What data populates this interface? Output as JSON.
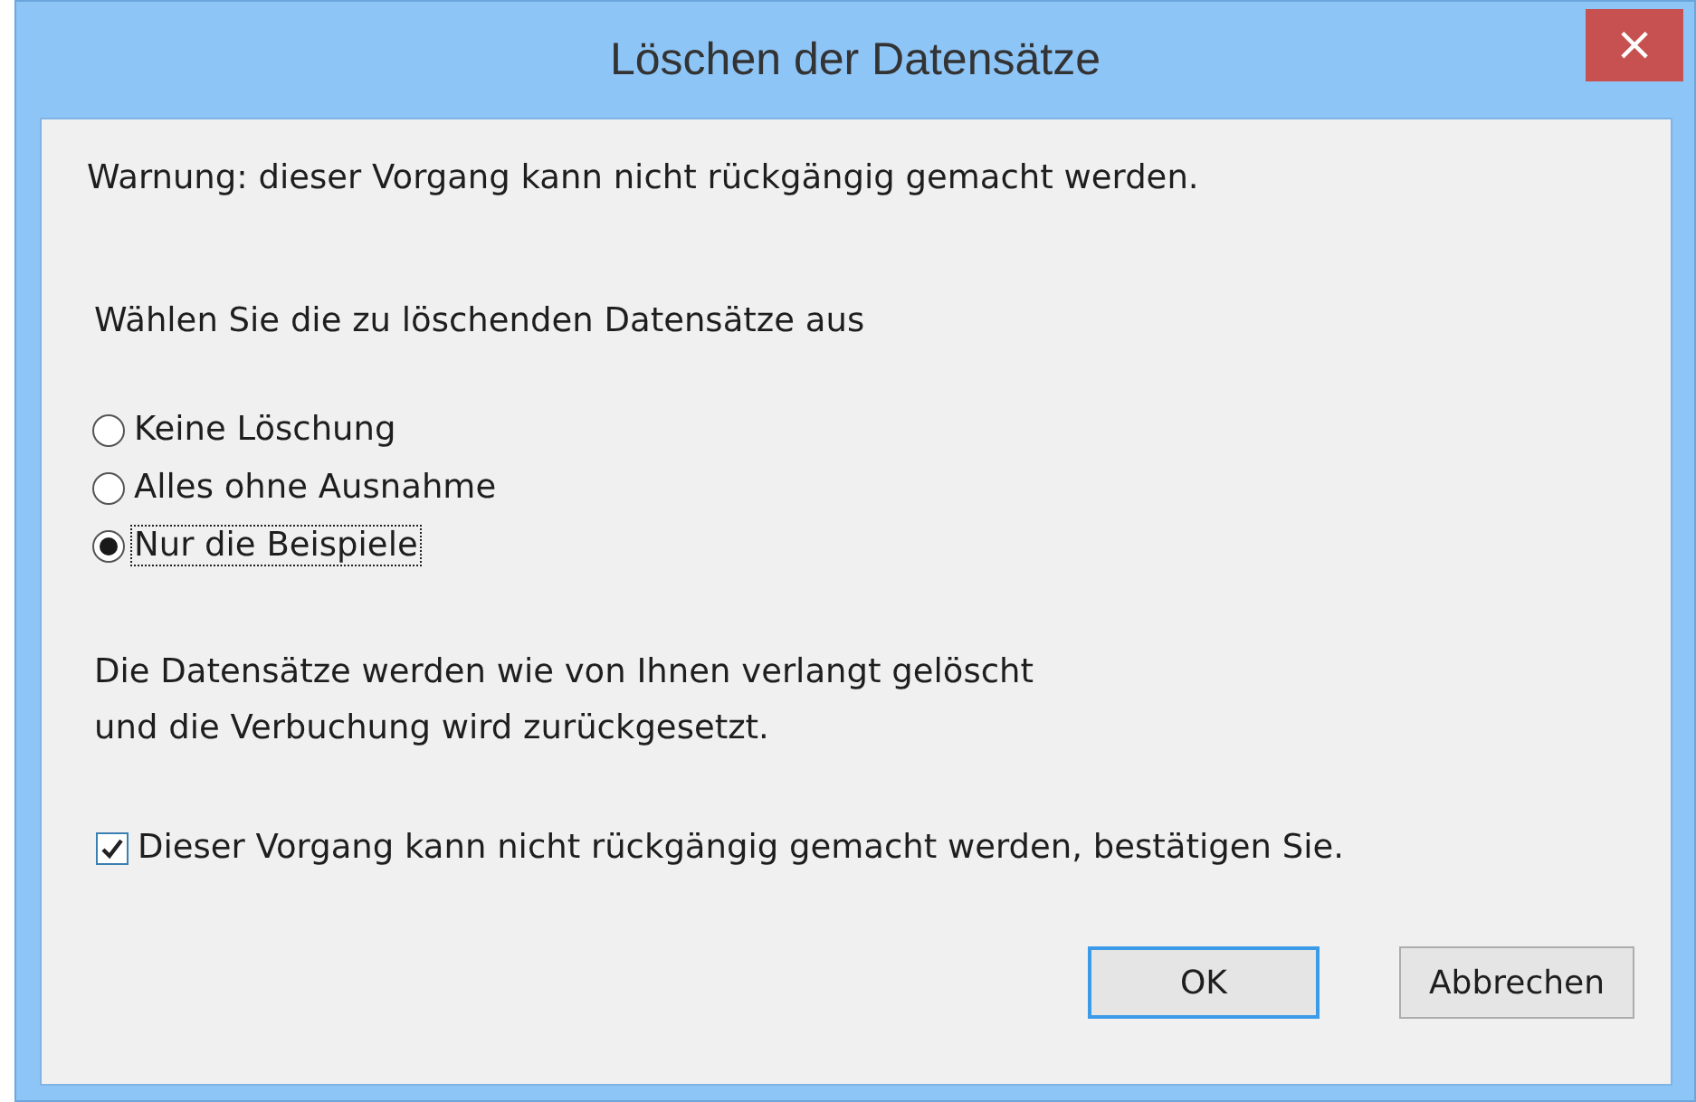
{
  "window": {
    "title": "Löschen der Datensätze",
    "close": "×"
  },
  "warning": "Warnung: dieser Vorgang kann nicht rückgängig gemacht werden.",
  "prompt": "Wählen Sie die zu löschenden Datensätze aus",
  "options": [
    {
      "label": "Keine Löschung",
      "selected": false
    },
    {
      "label": "Alles ohne Ausnahme",
      "selected": false
    },
    {
      "label": "Nur die Beispiele",
      "selected": true
    }
  ],
  "info_lines": [
    "Die Datensätze werden wie von Ihnen verlangt gelöscht",
    "und die Verbuchung wird zurückgesetzt."
  ],
  "confirm": {
    "label": "Dieser Vorgang kann nicht rückgängig gemacht werden, bestätigen Sie.",
    "checked": true
  },
  "buttons": [
    {
      "label": "OK",
      "default": true
    },
    {
      "label": "Abbrechen",
      "default": false
    }
  ]
}
